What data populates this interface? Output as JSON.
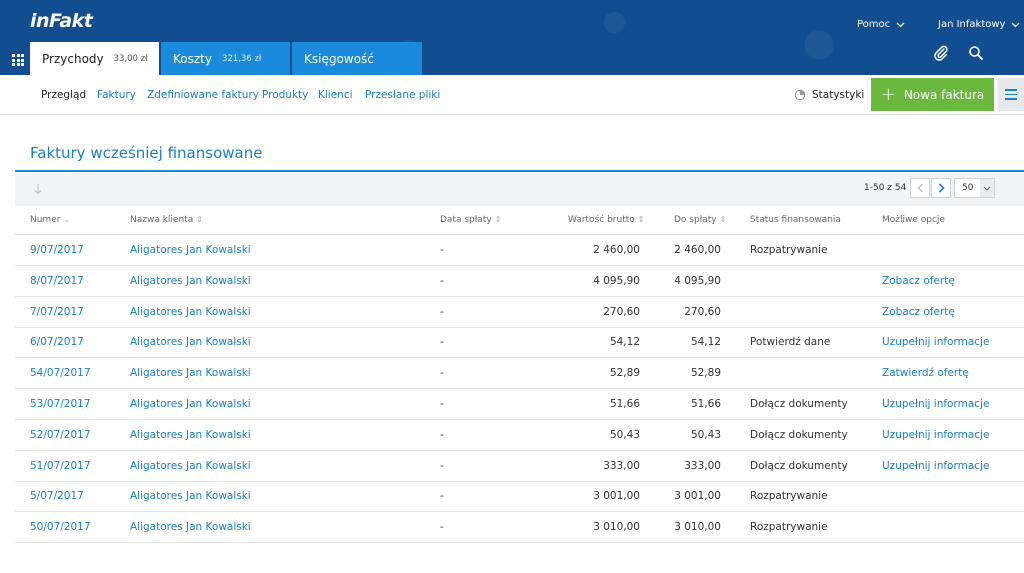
{
  "header": {
    "logo": "inFakt",
    "help_label": "Pomoc",
    "user_label": "Jan Infaktowy",
    "tabs": [
      {
        "label": "Przychody",
        "amount": "33,00 zł"
      },
      {
        "label": "Koszty",
        "amount": "321,36 zł"
      },
      {
        "label": "Księgowość",
        "amount": ""
      }
    ]
  },
  "subnav": {
    "items": [
      "Przegląd",
      "Faktury",
      "Zdefiniowane faktury",
      "Produkty",
      "Klienci",
      "Przesłane pliki"
    ],
    "stats_label": "Statystyki",
    "new_invoice_label": "Nowa faktura"
  },
  "page": {
    "title": "Faktury wcześniej finansowane"
  },
  "pager": {
    "range_text": "1-50 z 54",
    "per_page": "50"
  },
  "table": {
    "columns": [
      "Numer",
      "Nazwa klienta",
      "Data spłaty",
      "Wartość brutto",
      "Do spłaty",
      "Status finansowania",
      "Możliwe opcje"
    ],
    "rows": [
      {
        "number": "9/07/2017",
        "client": "Aligatores Jan Kowalski",
        "date": "-",
        "gross": "2 460,00",
        "due": "2 460,00",
        "status": "Rozpatrywanie",
        "option": ""
      },
      {
        "number": "8/07/2017",
        "client": "Aligatores Jan Kowalski",
        "date": "-",
        "gross": "4 095,90",
        "due": "4 095,90",
        "status": "",
        "option": "Zobacz ofertę"
      },
      {
        "number": "7/07/2017",
        "client": "Aligatores Jan Kowalski",
        "date": "-",
        "gross": "270,60",
        "due": "270,60",
        "status": "",
        "option": "Zobacz ofertę"
      },
      {
        "number": "6/07/2017",
        "client": "Aligatores Jan Kowalski",
        "date": "-",
        "gross": "54,12",
        "due": "54,12",
        "status": "Potwierdź dane",
        "option": "Uzupełnij informacje"
      },
      {
        "number": "54/07/2017",
        "client": "Aligatores Jan Kowalski",
        "date": "-",
        "gross": "52,89",
        "due": "52,89",
        "status": "",
        "option": "Zatwierdź ofertę"
      },
      {
        "number": "53/07/2017",
        "client": "Aligatores Jan Kowalski",
        "date": "-",
        "gross": "51,66",
        "due": "51,66",
        "status": "Dołącz dokumenty",
        "option": "Uzupełnij informacje"
      },
      {
        "number": "52/07/2017",
        "client": "Aligatores Jan Kowalski",
        "date": "-",
        "gross": "50,43",
        "due": "50,43",
        "status": "Dołącz dokumenty",
        "option": "Uzupełnij informacje"
      },
      {
        "number": "51/07/2017",
        "client": "Aligatores Jan Kowalski",
        "date": "-",
        "gross": "333,00",
        "due": "333,00",
        "status": "Dołącz dokumenty",
        "option": "Uzupełnij informacje"
      },
      {
        "number": "5/07/2017",
        "client": "Aligatores Jan Kowalski",
        "date": "-",
        "gross": "3 001,00",
        "due": "3 001,00",
        "status": "Rozpatrywanie",
        "option": ""
      },
      {
        "number": "50/07/2017",
        "client": "Aligatores Jan Kowalski",
        "date": "-",
        "gross": "3 010,00",
        "due": "3 010,00",
        "status": "Rozpatrywanie",
        "option": ""
      }
    ]
  },
  "colors": {
    "header_bg": "#124e8f",
    "tab_blue": "#1a8adc",
    "link": "#1a7ecb",
    "green_button": "#6ab83e"
  },
  "icons": [
    "grid-icon",
    "chevron-down-icon",
    "paperclip-icon",
    "search-icon",
    "pie-chart-icon",
    "plus-icon",
    "hamburger-icon",
    "sort-icon",
    "chevron-left-icon",
    "chevron-right-icon"
  ]
}
